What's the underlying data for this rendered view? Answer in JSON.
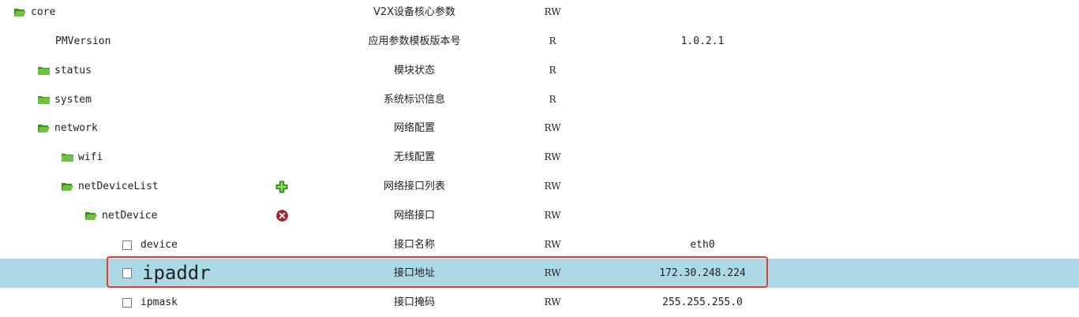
{
  "rows": [
    {
      "name": "core",
      "kind": "folder-open",
      "description": "V2X设备核心参数",
      "access": "RW",
      "value": ""
    },
    {
      "name": "PMVersion",
      "kind": "leaf-plain",
      "description": "应用参数模板版本号",
      "access": "R",
      "value": "1.0.2.1"
    },
    {
      "name": "status",
      "kind": "folder-closed",
      "description": "模块状态",
      "access": "R",
      "value": ""
    },
    {
      "name": "system",
      "kind": "folder-closed",
      "description": "系统标识信息",
      "access": "R",
      "value": ""
    },
    {
      "name": "network",
      "kind": "folder-open",
      "description": "网络配置",
      "access": "RW",
      "value": ""
    },
    {
      "name": "wifi",
      "kind": "folder-closed",
      "description": "无线配置",
      "access": "RW",
      "value": ""
    },
    {
      "name": "netDeviceList",
      "kind": "folder-open",
      "description": "网络接口列表",
      "access": "RW",
      "value": "",
      "action": "add-icon"
    },
    {
      "name": "netDevice",
      "kind": "folder-open",
      "description": "网络接口",
      "access": "RW",
      "value": "",
      "action": "remove-icon"
    },
    {
      "name": "device",
      "kind": "checkbox",
      "description": "接口名称",
      "access": "RW",
      "value": "eth0"
    },
    {
      "name": "ipaddr",
      "kind": "checkbox",
      "description": "接口地址",
      "access": "RW",
      "value": "172.30.248.224",
      "selected": true
    },
    {
      "name": "ipmask",
      "kind": "checkbox",
      "description": "接口掩码",
      "access": "RW",
      "value": "255.255.255.0"
    }
  ],
  "colors": {
    "selected_row": "#add8e6",
    "highlight_border": "#e33b2e",
    "folder_green": "#5aa832",
    "add_green": "#4caf2a",
    "remove_red": "#b3202a"
  }
}
